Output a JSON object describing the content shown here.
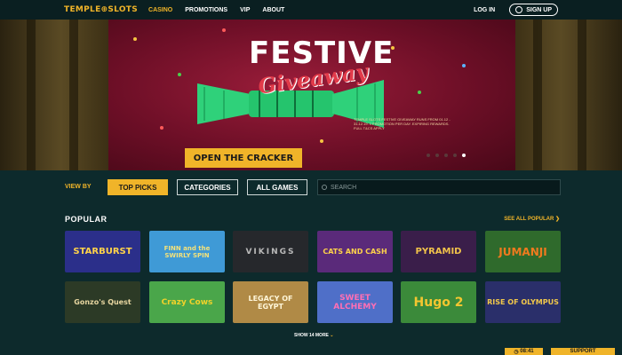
{
  "header": {
    "logo": "TEMPLE⊕SLOTS",
    "nav": [
      {
        "label": "CASINO",
        "active": true
      },
      {
        "label": "PROMOTIONS",
        "active": false
      },
      {
        "label": "VIP",
        "active": false
      },
      {
        "label": "ABOUT",
        "active": false
      }
    ],
    "login_label": "LOG IN",
    "signup_label": "SIGN UP"
  },
  "hero": {
    "title": "FESTIVE",
    "subtitle": "Giveaway",
    "fineprint": "TEMPLE SLOTS FESTIVE GIVEAWAY RUNS FROM 01.12 - 31.12.19. 1 PROMOTION PER DAY. EXPIRING REWARDS. FULL T&CS APPLY",
    "cta_label": "OPEN THE CRACKER",
    "slides": 5,
    "active_slide": 5
  },
  "filters": {
    "view_by_label": "VIEW BY",
    "buttons": [
      {
        "label": "TOP PICKS",
        "active": true
      },
      {
        "label": "CATEGORIES",
        "active": false
      },
      {
        "label": "ALL GAMES",
        "active": false
      }
    ],
    "search_placeholder": "SEARCH"
  },
  "section": {
    "title": "POPULAR",
    "see_all_label": "SEE ALL POPULAR ❯"
  },
  "games": [
    {
      "name": "STARBURST",
      "bg": "#2b2f8a",
      "fg": "#ffd34a"
    },
    {
      "name": "FINN and the SWIRLY SPIN",
      "bg": "#3f9ad6",
      "fg": "#f4e27a"
    },
    {
      "name": "VIKINGS",
      "bg": "#26282c",
      "fg": "#b9b9b9"
    },
    {
      "name": "CATS AND CASH",
      "bg": "#5a2a7a",
      "fg": "#ffd34a"
    },
    {
      "name": "PYRAMID",
      "bg": "#3a1e4a",
      "fg": "#f0c24a"
    },
    {
      "name": "JUMANJI",
      "bg": "#2f6a2c",
      "fg": "#f07a1e"
    },
    {
      "name": "Gonzo's Quest",
      "bg": "#2c3a26",
      "fg": "#e7d6a0"
    },
    {
      "name": "Crazy Cows",
      "bg": "#4aa64a",
      "fg": "#f0d22a"
    },
    {
      "name": "LEGACY OF EGYPT",
      "bg": "#b08a46",
      "fg": "#fff6d8"
    },
    {
      "name": "SWEET ALCHEMY",
      "bg": "#4f6fc8",
      "fg": "#ff6fb4"
    },
    {
      "name": "Hugo 2",
      "bg": "#3b8a3a",
      "fg": "#f4c630"
    },
    {
      "name": "RISE OF OLYMPUS",
      "bg": "#2a2f6a",
      "fg": "#f1c84a"
    }
  ],
  "show_more_label": "SHOW 14 MORE",
  "bottom": {
    "clock_label": "08:41",
    "support_label": "SUPPORT"
  },
  "colors": {
    "accent": "#f0b429",
    "background": "#0d2a2c"
  }
}
